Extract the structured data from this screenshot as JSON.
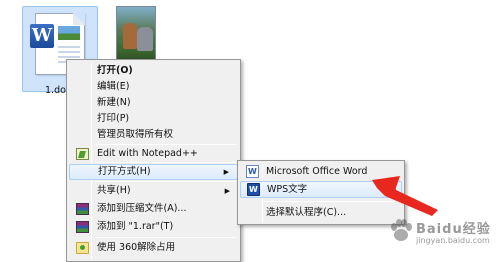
{
  "desktop": {
    "files": [
      {
        "label": "1.doc",
        "icon": "word-document-icon"
      },
      {
        "label": "",
        "icon": "image-thumbnail-icon"
      }
    ]
  },
  "context_menu": {
    "items": [
      {
        "label": "打开(O)",
        "bold": true
      },
      {
        "label": "编辑(E)"
      },
      {
        "label": "新建(N)"
      },
      {
        "label": "打印(P)"
      },
      {
        "label": "管理员取得所有权"
      },
      {
        "label": "Edit with Notepad++",
        "icon": "notepad-plus-plus-icon"
      },
      {
        "label": "打开方式(H)",
        "highlighted": true,
        "has_submenu": true
      },
      {
        "label": "共享(H)",
        "has_submenu": true
      },
      {
        "label": "添加到压缩文件(A)...",
        "icon": "winrar-icon"
      },
      {
        "label": "添加到 \"1.rar\"(T)",
        "icon": "winrar-icon"
      },
      {
        "label": "使用 360解除占用",
        "icon": "360-icon"
      }
    ],
    "submenu_arrow": "▶"
  },
  "open_with_submenu": {
    "items": [
      {
        "label": "Microsoft Office Word",
        "icon": "ms-word-icon"
      },
      {
        "label": "WPS文字",
        "icon": "wps-writer-icon",
        "highlighted": true
      },
      {
        "label": "选择默认程序(C)..."
      }
    ]
  },
  "annotation": {
    "color": "#e8281e",
    "icon": "red-arrow-pointer"
  },
  "watermark": {
    "text": "Baidu经验",
    "sub": "jingyan.baidu.com"
  }
}
